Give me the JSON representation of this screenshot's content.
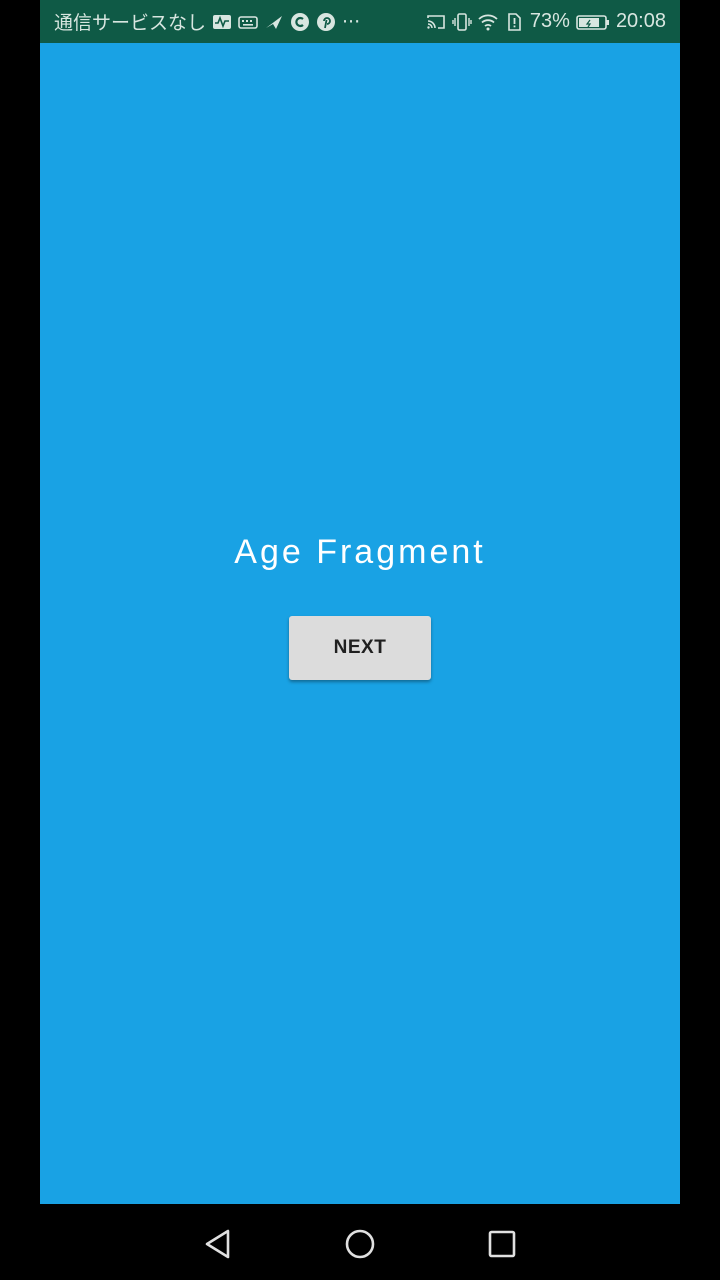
{
  "status_bar": {
    "carrier": "通信サービスなし",
    "overflow": "···",
    "battery_percent": "73%",
    "time": "20:08",
    "left_icons": [
      "activity-icon",
      "keyboard-icon",
      "send-icon",
      "c-app-icon",
      "pinterest-icon"
    ],
    "right_icons": [
      "cast-icon",
      "vibrate-icon",
      "wifi-icon",
      "sim-alert-icon",
      "battery-icon"
    ]
  },
  "main": {
    "title": "Age Fragment",
    "next_label": "NEXT"
  },
  "nav_bar": {
    "icons": [
      "back-icon",
      "home-icon",
      "recents-icon"
    ]
  },
  "colors": {
    "status_bar": "#0f5a46",
    "background": "#19a2e4",
    "button": "#dcdcdc",
    "title_text": "#ffffff"
  }
}
